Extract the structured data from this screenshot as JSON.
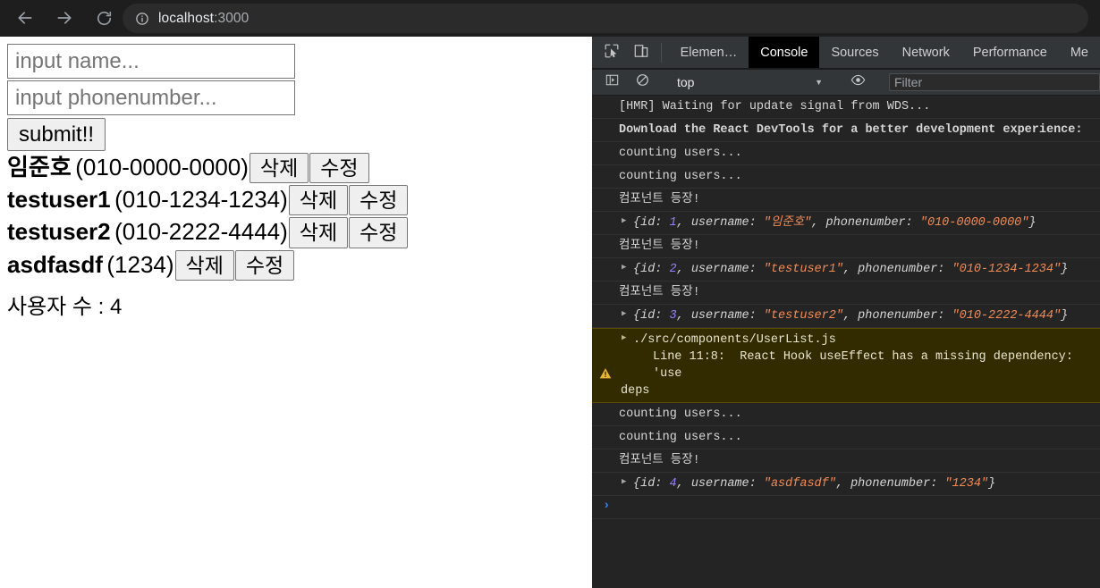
{
  "browser": {
    "back_icon": "arrow-left-icon",
    "forward_icon": "arrow-right-icon",
    "reload_icon": "reload-icon",
    "site_info_icon": "info-circle-icon",
    "url_host": "localhost",
    "url_port": ":3000"
  },
  "page": {
    "name_input": {
      "placeholder": "input name...",
      "value": ""
    },
    "phone_input": {
      "placeholder": "input phonenumber...",
      "value": ""
    },
    "submit_label": "submit!!",
    "users": [
      {
        "name": "임준호",
        "phone": "(010-0000-0000)",
        "delete_label": "삭제",
        "edit_label": "수정"
      },
      {
        "name": "testuser1",
        "phone": "(010-1234-1234)",
        "delete_label": "삭제",
        "edit_label": "수정"
      },
      {
        "name": "testuser2",
        "phone": "(010-2222-4444)",
        "delete_label": "삭제",
        "edit_label": "수정"
      },
      {
        "name": "asdfasdf",
        "phone": "(1234)",
        "delete_label": "삭제",
        "edit_label": "수정"
      }
    ],
    "user_count_text": "사용자 수 : 4"
  },
  "devtools": {
    "inspect_icon": "inspect-element-icon",
    "device_icon": "device-toolbar-icon",
    "tabs": [
      {
        "label": "Elemen…",
        "active": false
      },
      {
        "label": "Console",
        "active": true
      },
      {
        "label": "Sources",
        "active": false
      },
      {
        "label": "Network",
        "active": false
      },
      {
        "label": "Performance",
        "active": false
      },
      {
        "label": "Me",
        "active": false
      }
    ],
    "toolbar": {
      "sidebar_icon": "console-sidebar-icon",
      "clear_icon": "clear-console-icon",
      "context_value": "top",
      "context_caret": "▼",
      "eye_icon": "live-expression-eye-icon",
      "filter_placeholder": "Filter",
      "filter_value": ""
    },
    "messages": [
      {
        "type": "log",
        "text": "[HMR] Waiting for update signal from WDS..."
      },
      {
        "type": "bold",
        "text": "Download the React DevTools for a better development experience: "
      },
      {
        "type": "log",
        "text": "counting users..."
      },
      {
        "type": "log",
        "text": "counting users..."
      },
      {
        "type": "log",
        "text": "컴포넌트 등장!"
      },
      {
        "type": "object",
        "id": "1",
        "username": "임준호",
        "phonenumber": "010-0000-0000"
      },
      {
        "type": "log",
        "text": "컴포넌트 등장!"
      },
      {
        "type": "object",
        "id": "2",
        "username": "testuser1",
        "phonenumber": "010-1234-1234"
      },
      {
        "type": "log",
        "text": "컴포넌트 등장!"
      },
      {
        "type": "object",
        "id": "3",
        "username": "testuser2",
        "phonenumber": "010-2222-4444"
      },
      {
        "type": "warning",
        "icon": "warning-triangle-icon",
        "file": "./src/components/UserList.js",
        "line2": "Line 11:8:  React Hook useEffect has a missing dependency: 'use",
        "line3": "deps"
      },
      {
        "type": "log",
        "text": "counting users..."
      },
      {
        "type": "log",
        "text": "counting users..."
      },
      {
        "type": "log",
        "text": "컴포넌트 등장!"
      },
      {
        "type": "object",
        "id": "4",
        "username": "asdfasdf",
        "phonenumber": "1234"
      }
    ],
    "prompt_caret": "›"
  },
  "colors": {
    "chrome_bg": "#1e1e1e",
    "devtools_bg": "#242424",
    "devtools_toolbar_bg": "#333639",
    "active_tab_bg": "#000000",
    "warning_bg": "#332b00",
    "warning_border": "#5c4b00",
    "string_token": "#f28b54",
    "number_token": "#9a7fff",
    "prompt_blue": "#3b82f6"
  }
}
